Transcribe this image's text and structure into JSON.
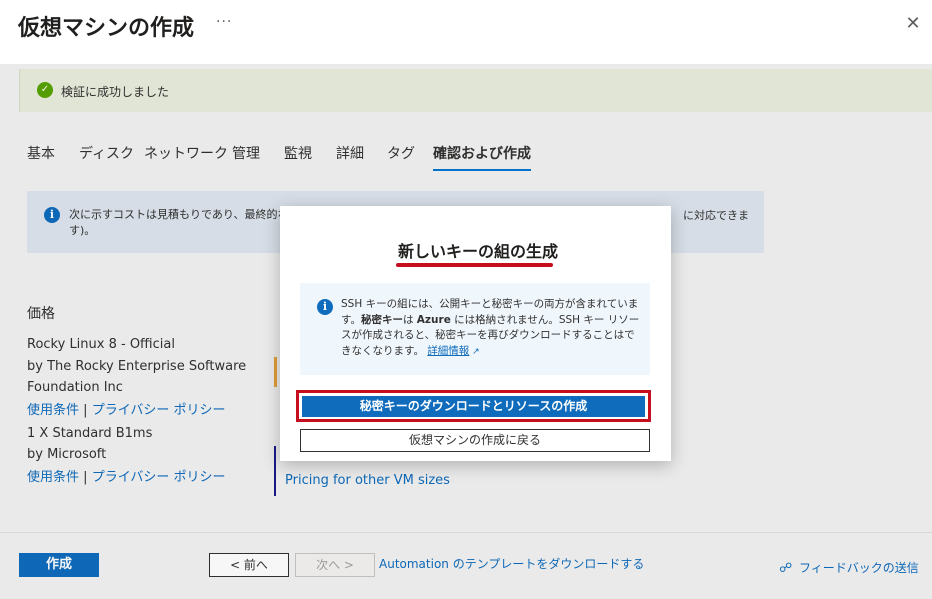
{
  "header": {
    "title": "仮想マシンの作成",
    "more": "···",
    "close": "✕"
  },
  "validation": {
    "icon": "check-icon",
    "text": "検証に成功しました"
  },
  "tabs": [
    {
      "label": "基本"
    },
    {
      "label": "ディスク"
    },
    {
      "label": "ネットワーク"
    },
    {
      "label": "管理"
    },
    {
      "label": "監視"
    },
    {
      "label": "詳細"
    },
    {
      "label": "タグ"
    },
    {
      "label": "確認および作成",
      "active": true
    }
  ],
  "cost_notice": {
    "line1_head": "次に示すコストは見積もりであり、最終的な価",
    "line1_tail": "に対応できま",
    "line2": "す)。"
  },
  "pricing": {
    "section_title": "価格",
    "product_name": "Rocky Linux 8 - Official",
    "publisher_line1": "by The Rocky Enterprise Software",
    "publisher_line2": "Foundation Inc",
    "terms_link": "使用条件",
    "separator": "|",
    "privacy_link": "プライバシー ポリシー",
    "vm_size": "1 X Standard B1ms",
    "vm_publisher": "by Microsoft",
    "vm_terms_link": "使用条件",
    "vm_privacy_link": "プライバシー ポリシー",
    "pricing_other": "Pricing for other VM sizes"
  },
  "footer": {
    "create": "作成",
    "prev": "< 前へ",
    "next": "次へ >",
    "download_template": "Automation のテンプレートをダウンロードする",
    "feedback": "フィードバックの送信"
  },
  "modal": {
    "title": "新しいキーの組の生成",
    "info_part1": "SSH キーの組には、公開キーと秘密キーの両方が含まれています。",
    "info_bold1": "秘密キー",
    "info_part2": "は",
    "info_bold2": "Azure",
    "info_part3": "には格納されません。SSH キー リソースが作成されると、秘密キーを再びダウンロードすることはできなくなります。",
    "info_link": "詳細情報",
    "primary_button": "秘密キーのダウンロードとリソースの作成",
    "secondary_button": "仮想マシンの作成に戻る"
  },
  "colors": {
    "accent": "#0f6cbd",
    "success": "#57a300",
    "highlight": "#c50f1f"
  }
}
